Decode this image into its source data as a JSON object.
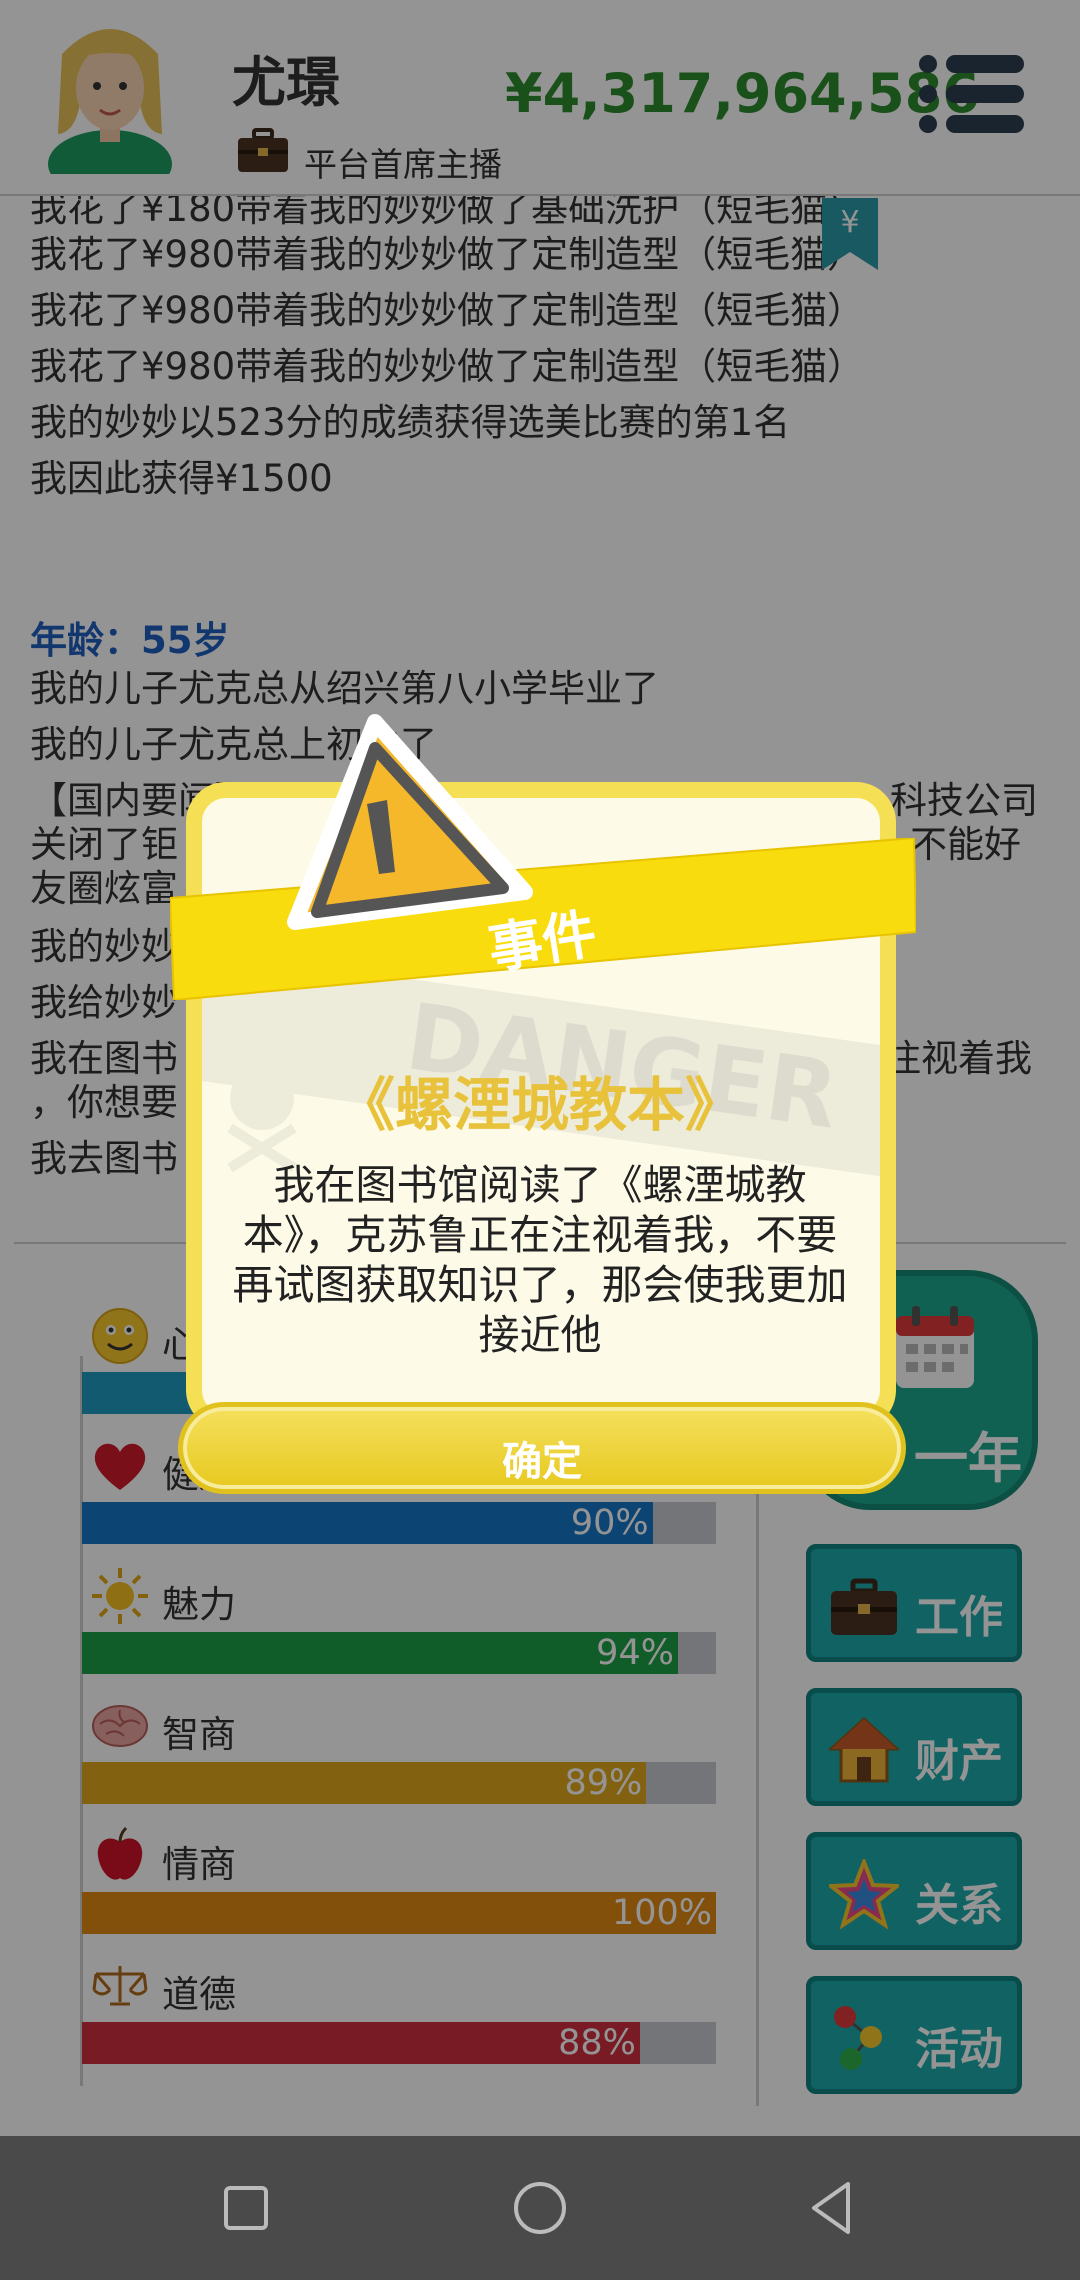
{
  "header": {
    "name": "尤璟",
    "job_title": "平台首席主播",
    "money": "¥4,317,964,586",
    "menu_icon": "menu-list-icon",
    "yen_tag_icon": "yen-bookmark-icon"
  },
  "log": {
    "lines_top": [
      "我花了¥180带着我的妙妙做了基础洗护（短毛猫）",
      "我花了¥980带着我的妙妙做了定制造型（短毛猫）",
      "我花了¥980带着我的妙妙做了定制造型（短毛猫）",
      "我花了¥980带着我的妙妙做了定制造型（短毛猫）",
      "我的妙妙以523分的成绩获得选美比赛的第1名",
      "我因此获得¥1500"
    ],
    "age_label": "年龄：55岁",
    "lines_bottom": [
      "我的儿子尤克总从绍兴第八小学毕业了",
      "我的儿子尤克总上初中了",
      "【国内要闻】",
      "科技公司",
      "关闭了钜",
      "不能好",
      "友圈炫富",
      "我的妙妙",
      "我给妙妙",
      "我在图书",
      "注视着我",
      "，你想要",
      "我去图书"
    ]
  },
  "stats": [
    {
      "label": "心情",
      "icon": "smiley-icon",
      "percent": 95,
      "pct_text": "",
      "color": "#1f9cc0"
    },
    {
      "label": "健康",
      "icon": "heart-icon",
      "percent": 90,
      "pct_text": "90%",
      "color": "#1677c9"
    },
    {
      "label": "魅力",
      "icon": "sun-icon",
      "percent": 94,
      "pct_text": "94%",
      "color": "#1ea048"
    },
    {
      "label": "智商",
      "icon": "brain-icon",
      "percent": 89,
      "pct_text": "89%",
      "color": "#e1a91c"
    },
    {
      "label": "情商",
      "icon": "apple-icon",
      "percent": 100,
      "pct_text": "100%",
      "color": "#e08a12"
    },
    {
      "label": "道德",
      "icon": "scales-icon",
      "percent": 88,
      "pct_text": "88%",
      "color": "#d0303f"
    }
  ],
  "actions": {
    "next_year": "一年",
    "work": "工作",
    "assets": "财产",
    "relations": "关系",
    "activities": "活动"
  },
  "modal": {
    "title": "事件",
    "book_title": "《螺湮城教本》",
    "body": "我在图书馆阅读了《螺湮城教本》，克苏鲁正在注视着我，不要再试图获取知识了，那会使我更加接近他",
    "watermark": "DANGER",
    "ok_label": "确定"
  },
  "sys_nav": {
    "recent": "square-recent-apps-icon",
    "home": "circle-home-icon",
    "back": "triangle-back-icon"
  }
}
